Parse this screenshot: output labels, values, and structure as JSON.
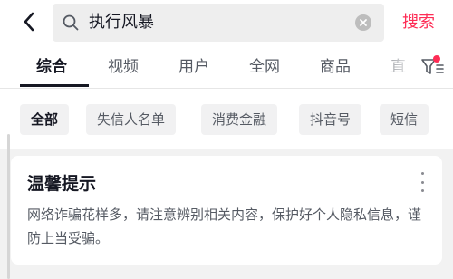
{
  "header": {
    "query": "执行风暴",
    "search_label": "搜索",
    "back_icon": "chevron-left-icon",
    "search_icon": "search-icon",
    "clear_icon": "clear-icon",
    "accent_color": "#fe2c55"
  },
  "tabs": [
    {
      "label": "综合",
      "active": true
    },
    {
      "label": "视频"
    },
    {
      "label": "用户"
    },
    {
      "label": "全网"
    },
    {
      "label": "商品"
    },
    {
      "label": "直"
    }
  ],
  "filter": {
    "icon": "filter-icon",
    "has_notification": true
  },
  "chips": [
    {
      "label": "全部",
      "active": true
    },
    {
      "label": "失信人名单"
    },
    {
      "label": "消费金融"
    },
    {
      "label": "抖音号"
    },
    {
      "label": "短信"
    }
  ],
  "notice": {
    "title": "温馨提示",
    "body": "网络诈骗花样多，请注意辨别相关内容，保护好个人隐私信息，谨防上当受骗。",
    "more_icon": "more-vertical-icon"
  }
}
